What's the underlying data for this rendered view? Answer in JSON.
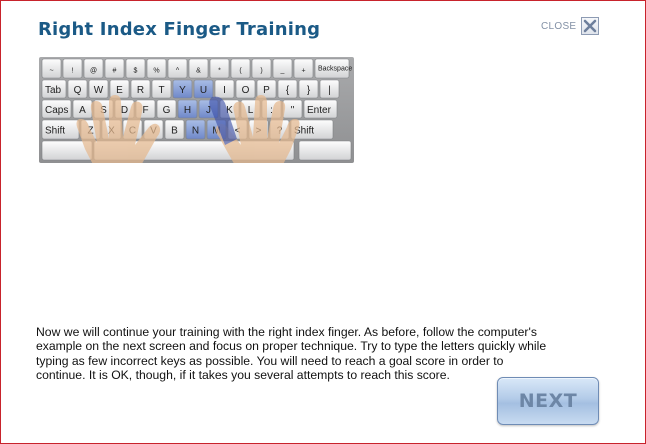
{
  "window": {
    "title": "Right Index Finger Training",
    "close_label": "CLOSE",
    "close_icon": "close-icon"
  },
  "keyboard": {
    "description_keys_row0": [
      "~",
      "!",
      "@",
      "#",
      "$",
      "%",
      "^",
      "&",
      "*",
      "(",
      ")",
      "_",
      "+",
      "Backspace"
    ],
    "row1": [
      "Tab",
      "Q",
      "W",
      "E",
      "R",
      "T",
      "Y",
      "U",
      "I",
      "O",
      "P",
      "{",
      "}",
      "|"
    ],
    "row2": [
      "Caps",
      "A",
      "S",
      "D",
      "F",
      "G",
      "H",
      "J",
      "K",
      "L",
      ":",
      "\"",
      "Enter"
    ],
    "row3": [
      "Shift",
      "Z",
      "X",
      "C",
      "V",
      "B",
      "N",
      "M",
      "<",
      ">",
      "?",
      "Shift"
    ],
    "highlighted_keys": [
      "Y",
      "U",
      "H",
      "J",
      "N",
      "M"
    ],
    "highlight_color": "#5a78c8",
    "hand_color": "#e5b98f"
  },
  "instructions": {
    "text": "Now we will continue your training with the right index finger. As before, follow the computer's example on the next screen and focus on proper technique. Try to type the letters quickly while typing as few incorrect keys as possible. You will need to reach a goal score in order to continue. It is OK, though, if it takes you several attempts to reach this score."
  },
  "buttons": {
    "next_label": "NEXT"
  },
  "colors": {
    "title": "#1b5a86",
    "border": "#c8232c",
    "next_text": "#6d86a6"
  }
}
